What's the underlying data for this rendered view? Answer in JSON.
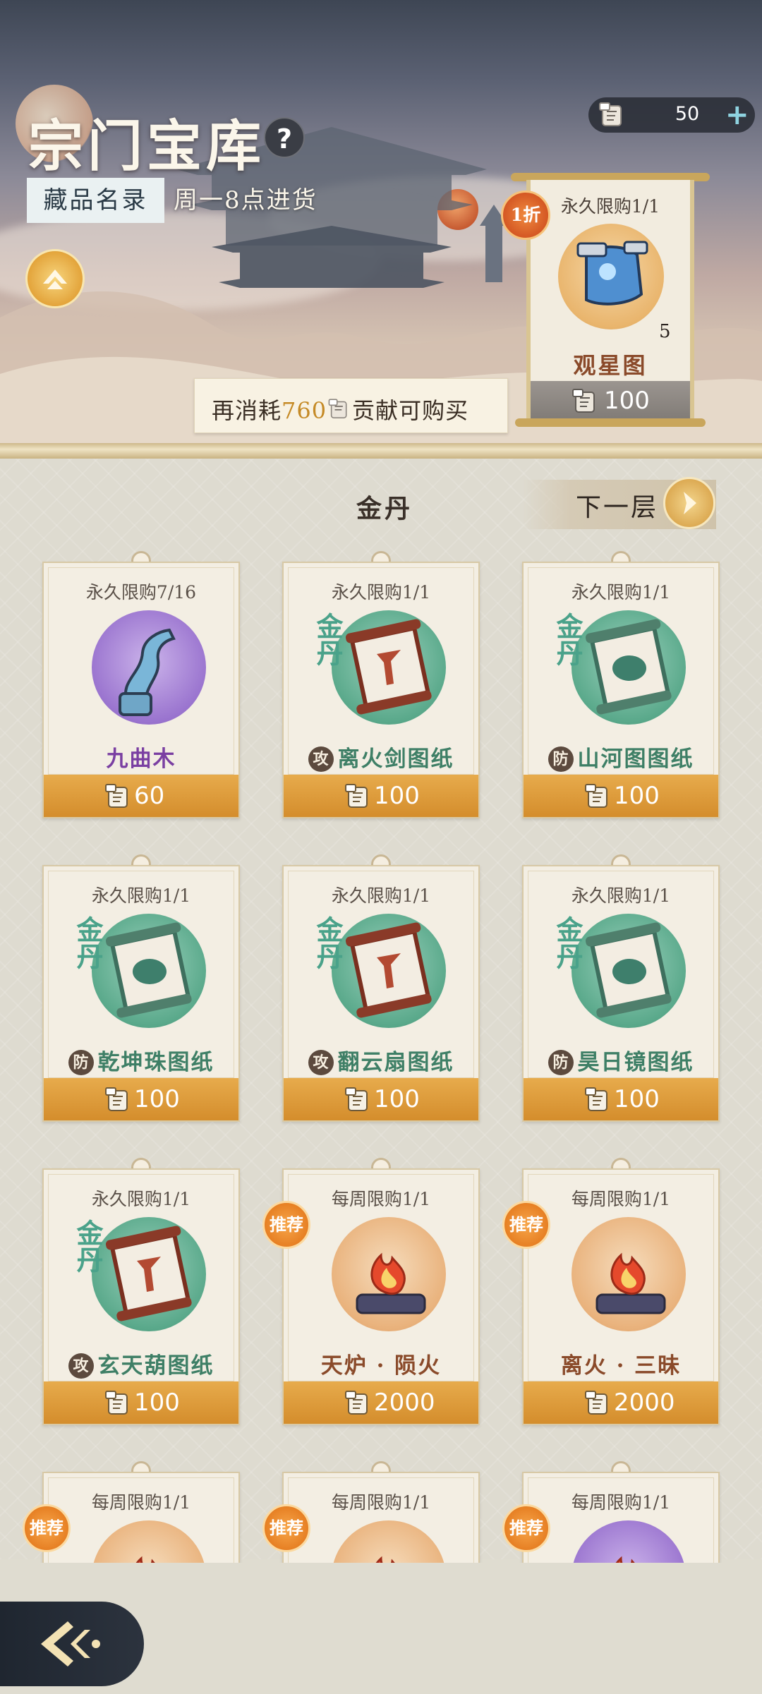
{
  "header": {
    "title": "宗门宝库",
    "help": "?",
    "catalog_tab": "藏品名录",
    "restock": "周一8点进货",
    "currency": {
      "value": "50",
      "plus": "+"
    },
    "consume": {
      "prefix": "再消耗",
      "amount": "760",
      "suffix": "贡献可购买"
    }
  },
  "featured": {
    "limit": "永久限购1/1",
    "discount": "1折",
    "quantity": "5",
    "name": "观星图",
    "price": "100"
  },
  "shelf": {
    "tier_title": "金丹",
    "next_label": "下一层"
  },
  "items": [
    {
      "limit": "永久限购7/16",
      "name": "九曲木",
      "type": "",
      "tier_mark": "",
      "price": "60",
      "art": "purple",
      "recommend": "",
      "color": "#7a3fa2",
      "icon": "twisted-wood-icon"
    },
    {
      "limit": "永久限购1/1",
      "name": "离火剑图纸",
      "type": "攻",
      "tier_mark": "金丹",
      "price": "100",
      "art": "green",
      "recommend": "",
      "color": "#3e7f66",
      "icon": "red-scroll-icon"
    },
    {
      "limit": "永久限购1/1",
      "name": "山河图图纸",
      "type": "防",
      "tier_mark": "金丹",
      "price": "100",
      "art": "green",
      "recommend": "",
      "color": "#3e7f66",
      "icon": "green-scroll-icon"
    },
    {
      "limit": "永久限购1/1",
      "name": "乾坤珠图纸",
      "type": "防",
      "tier_mark": "金丹",
      "price": "100",
      "art": "green",
      "recommend": "",
      "color": "#3e7f66",
      "icon": "green-scroll-icon"
    },
    {
      "limit": "永久限购1/1",
      "name": "翻云扇图纸",
      "type": "攻",
      "tier_mark": "金丹",
      "price": "100",
      "art": "green",
      "recommend": "",
      "color": "#3e7f66",
      "icon": "red-scroll-icon"
    },
    {
      "limit": "永久限购1/1",
      "name": "昊日镜图纸",
      "type": "防",
      "tier_mark": "金丹",
      "price": "100",
      "art": "green",
      "recommend": "",
      "color": "#3e7f66",
      "icon": "green-scroll-icon"
    },
    {
      "limit": "永久限购1/1",
      "name": "玄天葫图纸",
      "type": "攻",
      "tier_mark": "金丹",
      "price": "100",
      "art": "green",
      "recommend": "",
      "color": "#3e7f66",
      "icon": "red-scroll-icon"
    },
    {
      "limit": "每周限购1/1",
      "name": "天炉 · 陨火",
      "type": "",
      "tier_mark": "",
      "price": "2000",
      "art": "orange",
      "recommend": "推荐",
      "color": "#8a4a2a",
      "icon": "flame-icon"
    },
    {
      "limit": "每周限购1/1",
      "name": "离火 · 三昧",
      "type": "",
      "tier_mark": "",
      "price": "2000",
      "art": "orange",
      "recommend": "推荐",
      "color": "#8a4a2a",
      "icon": "flame-icon"
    },
    {
      "limit": "每周限购1/1",
      "name": "",
      "type": "",
      "tier_mark": "",
      "price": "",
      "art": "orange",
      "recommend": "推荐",
      "color": "#8a4a2a",
      "icon": "flame-icon"
    },
    {
      "limit": "每周限购1/1",
      "name": "",
      "type": "",
      "tier_mark": "",
      "price": "",
      "art": "orange",
      "recommend": "推荐",
      "color": "#8a4a2a",
      "icon": "flame-icon"
    },
    {
      "limit": "每周限购1/1",
      "name": "",
      "type": "",
      "tier_mark": "",
      "price": "",
      "art": "purple",
      "recommend": "推荐",
      "color": "#8a4a2a",
      "icon": "flame-icon"
    }
  ],
  "footer": {
    "back_icon": "back-arrow-icon"
  }
}
